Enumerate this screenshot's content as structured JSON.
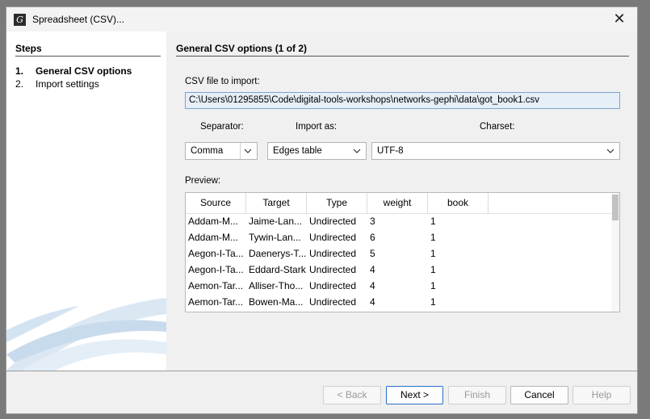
{
  "window": {
    "title": "Spreadsheet (CSV)...",
    "close_glyph": "✕"
  },
  "steps": {
    "header": "Steps",
    "items": [
      {
        "num": "1.",
        "label": "General CSV options"
      },
      {
        "num": "2.",
        "label": "Import settings"
      }
    ]
  },
  "main": {
    "header": "General CSV options (1 of 2)",
    "file_label": "CSV file to import:",
    "file_path": "C:\\Users\\01295855\\Code\\digital-tools-workshops\\networks-gephi\\data\\got_book1.csv",
    "separator_label": "Separator:",
    "separator_value": "Comma",
    "import_as_label": "Import as:",
    "import_as_value": "Edges table",
    "charset_label": "Charset:",
    "charset_value": "UTF-8",
    "preview_label": "Preview:"
  },
  "preview": {
    "columns": [
      "Source",
      "Target",
      "Type",
      "weight",
      "book",
      ""
    ],
    "rows": [
      [
        "Addam-M...",
        "Jaime-Lan...",
        "Undirected",
        "3",
        "1"
      ],
      [
        "Addam-M...",
        "Tywin-Lan...",
        "Undirected",
        "6",
        "1"
      ],
      [
        "Aegon-I-Ta...",
        "Daenerys-T...",
        "Undirected",
        "5",
        "1"
      ],
      [
        "Aegon-I-Ta...",
        "Eddard-Stark",
        "Undirected",
        "4",
        "1"
      ],
      [
        "Aemon-Tar...",
        "Alliser-Tho...",
        "Undirected",
        "4",
        "1"
      ],
      [
        "Aemon-Tar...",
        "Bowen-Ma...",
        "Undirected",
        "4",
        "1"
      ]
    ]
  },
  "buttons": {
    "back": "< Back",
    "next": "Next >",
    "finish": "Finish",
    "cancel": "Cancel",
    "help": "Help"
  },
  "colors": {
    "accent": "#2a6fc9",
    "file_field_bg": "#e6eef7"
  }
}
